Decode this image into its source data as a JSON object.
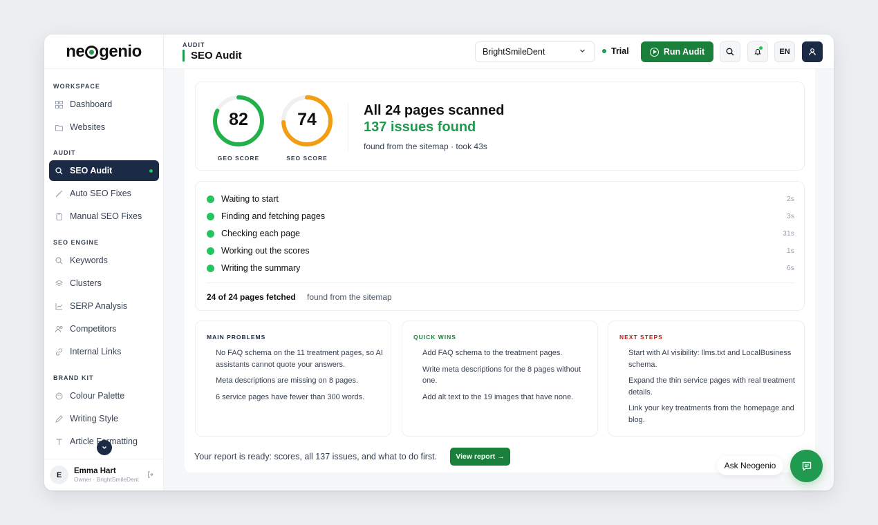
{
  "app": {
    "logo_left": "ne",
    "logo_right": "genio"
  },
  "sidebar": {
    "sections": [
      "WORKSPACE",
      "AUDIT",
      "SEO ENGINE",
      "BRAND KIT"
    ],
    "items": [
      {
        "label": "Dashboard",
        "icon": "grid-icon"
      },
      {
        "label": "Websites",
        "icon": "folder-icon"
      },
      {
        "label": "SEO Audit",
        "icon": "search-icon",
        "active": true
      },
      {
        "label": "Auto SEO Fixes",
        "icon": "wand-icon"
      },
      {
        "label": "Manual SEO Fixes",
        "icon": "clipboard-icon"
      },
      {
        "label": "Keywords",
        "icon": "search-icon"
      },
      {
        "label": "Clusters",
        "icon": "layers-icon"
      },
      {
        "label": "SERP Analysis",
        "icon": "chart-icon"
      },
      {
        "label": "Competitors",
        "icon": "users-icon"
      },
      {
        "label": "Internal Links",
        "icon": "link-icon"
      },
      {
        "label": "Colour Palette",
        "icon": "palette-icon"
      },
      {
        "label": "Writing Style",
        "icon": "pen-icon"
      },
      {
        "label": "Article Formatting",
        "icon": "type-icon"
      }
    ],
    "user": {
      "initial": "E",
      "name": "Emma Hart",
      "role": "Owner · BrightSmileDent"
    }
  },
  "header": {
    "crumb": "AUDIT",
    "title": "SEO Audit",
    "site": "BrightSmileDent",
    "plan": "Trial",
    "run_label": "Run Audit",
    "lang": "EN"
  },
  "scores": [
    {
      "value": "82",
      "label": "GEO SCORE",
      "fraction": 0.82,
      "color": "#22b04b"
    },
    {
      "value": "74",
      "label": "SEO SCORE",
      "fraction": 0.74,
      "color": "#f29d12"
    }
  ],
  "scan": {
    "title": "All 24 pages scanned",
    "issues": "137 issues found",
    "sub": "found from the sitemap · took 43s"
  },
  "steps": [
    {
      "label": "Waiting to start",
      "time": "2s"
    },
    {
      "label": "Finding and fetching pages",
      "time": "3s"
    },
    {
      "label": "Checking each page",
      "time": "31s"
    },
    {
      "label": "Working out the scores",
      "time": "1s"
    },
    {
      "label": "Writing the summary",
      "time": "6s"
    }
  ],
  "fetched": {
    "count": "24 of 24 pages fetched",
    "note": "found from the sitemap"
  },
  "columns": [
    {
      "title": "MAIN PROBLEMS",
      "color": "#1b2a45",
      "items": [
        "No FAQ schema on the 11 treatment pages, so AI assistants cannot quote your answers.",
        "Meta descriptions are missing on 8 pages.",
        "6 service pages have fewer than 300 words."
      ]
    },
    {
      "title": "QUICK WINS",
      "color": "#1a7f3a",
      "items": [
        "Add FAQ schema to the treatment pages.",
        "Write meta descriptions for the 8 pages without one.",
        "Add alt text to the 19 images that have none."
      ]
    },
    {
      "title": "NEXT STEPS",
      "color": "#b42318",
      "items": [
        "Start with AI visibility: llms.txt and LocalBusiness schema.",
        "Expand the thin service pages with real treatment details.",
        "Link your key treatments from the homepage and blog."
      ]
    }
  ],
  "footer": {
    "ready": "Your report is ready: scores, all 137 issues, and what to do first.",
    "view_label": "View report →"
  },
  "assistant": {
    "ask_label": "Ask Neogenio"
  }
}
